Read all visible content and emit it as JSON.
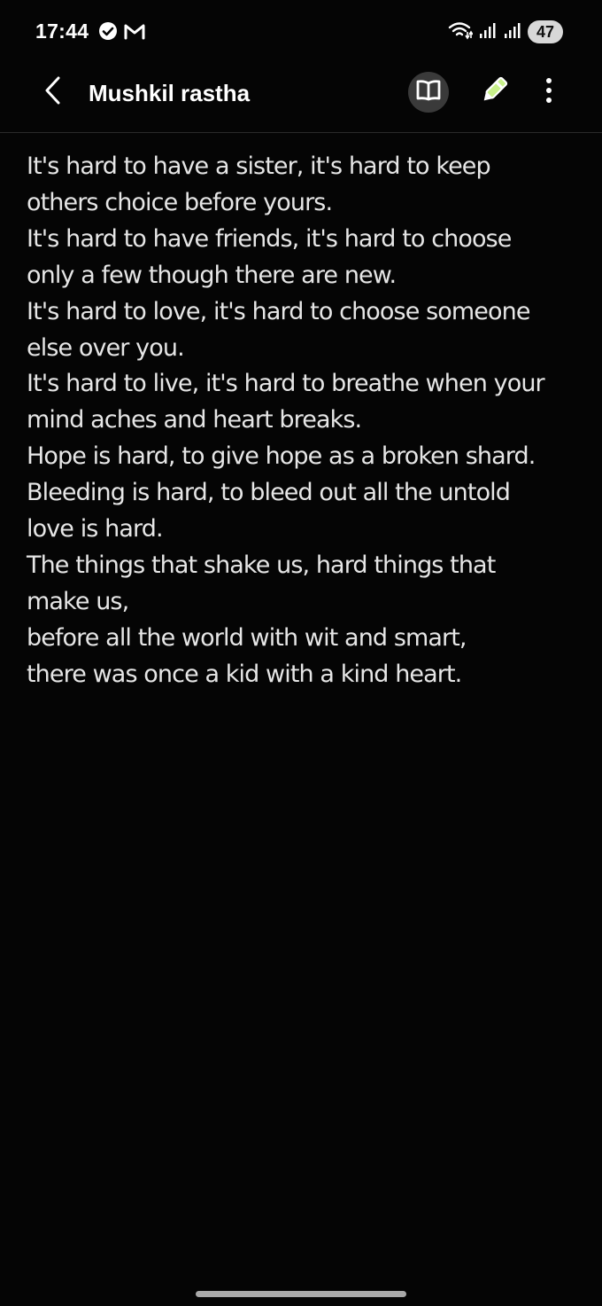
{
  "status_bar": {
    "time": "17:44",
    "battery_level": "47",
    "left_icons": [
      "check-circle-icon",
      "gmail-icon"
    ],
    "right_icons": [
      "wifi-icon",
      "signal-icon",
      "signal-icon"
    ]
  },
  "app_bar": {
    "title": "Mushkil rastha",
    "icons": [
      "back-arrow-icon",
      "book-open-icon",
      "pen-icon",
      "more-vertical-icon"
    ]
  },
  "note": {
    "lines": [
      "It's hard to have a sister, it's hard to keep",
      "others choice before yours.",
      "It's hard to have friends, it's hard to choose",
      "only a few though there are new.",
      "It's hard to love, it's hard to choose someone",
      "else over you.",
      "It's hard to live, it's hard to breathe when your",
      "mind aches and heart breaks.",
      "Hope is hard, to give hope as a broken shard.",
      "Bleeding is hard, to bleed out all the untold",
      "love is hard.",
      "The things that shake us, hard things that",
      "make us,",
      "before all the world with wit and smart,",
      "there was once a kid with a kind heart."
    ]
  },
  "colors": {
    "background": "#050505",
    "text": "#e6e6e6",
    "title": "#ffffff",
    "icon_chip": "#3a3a3a",
    "pen_accent": "#c8f08a"
  }
}
